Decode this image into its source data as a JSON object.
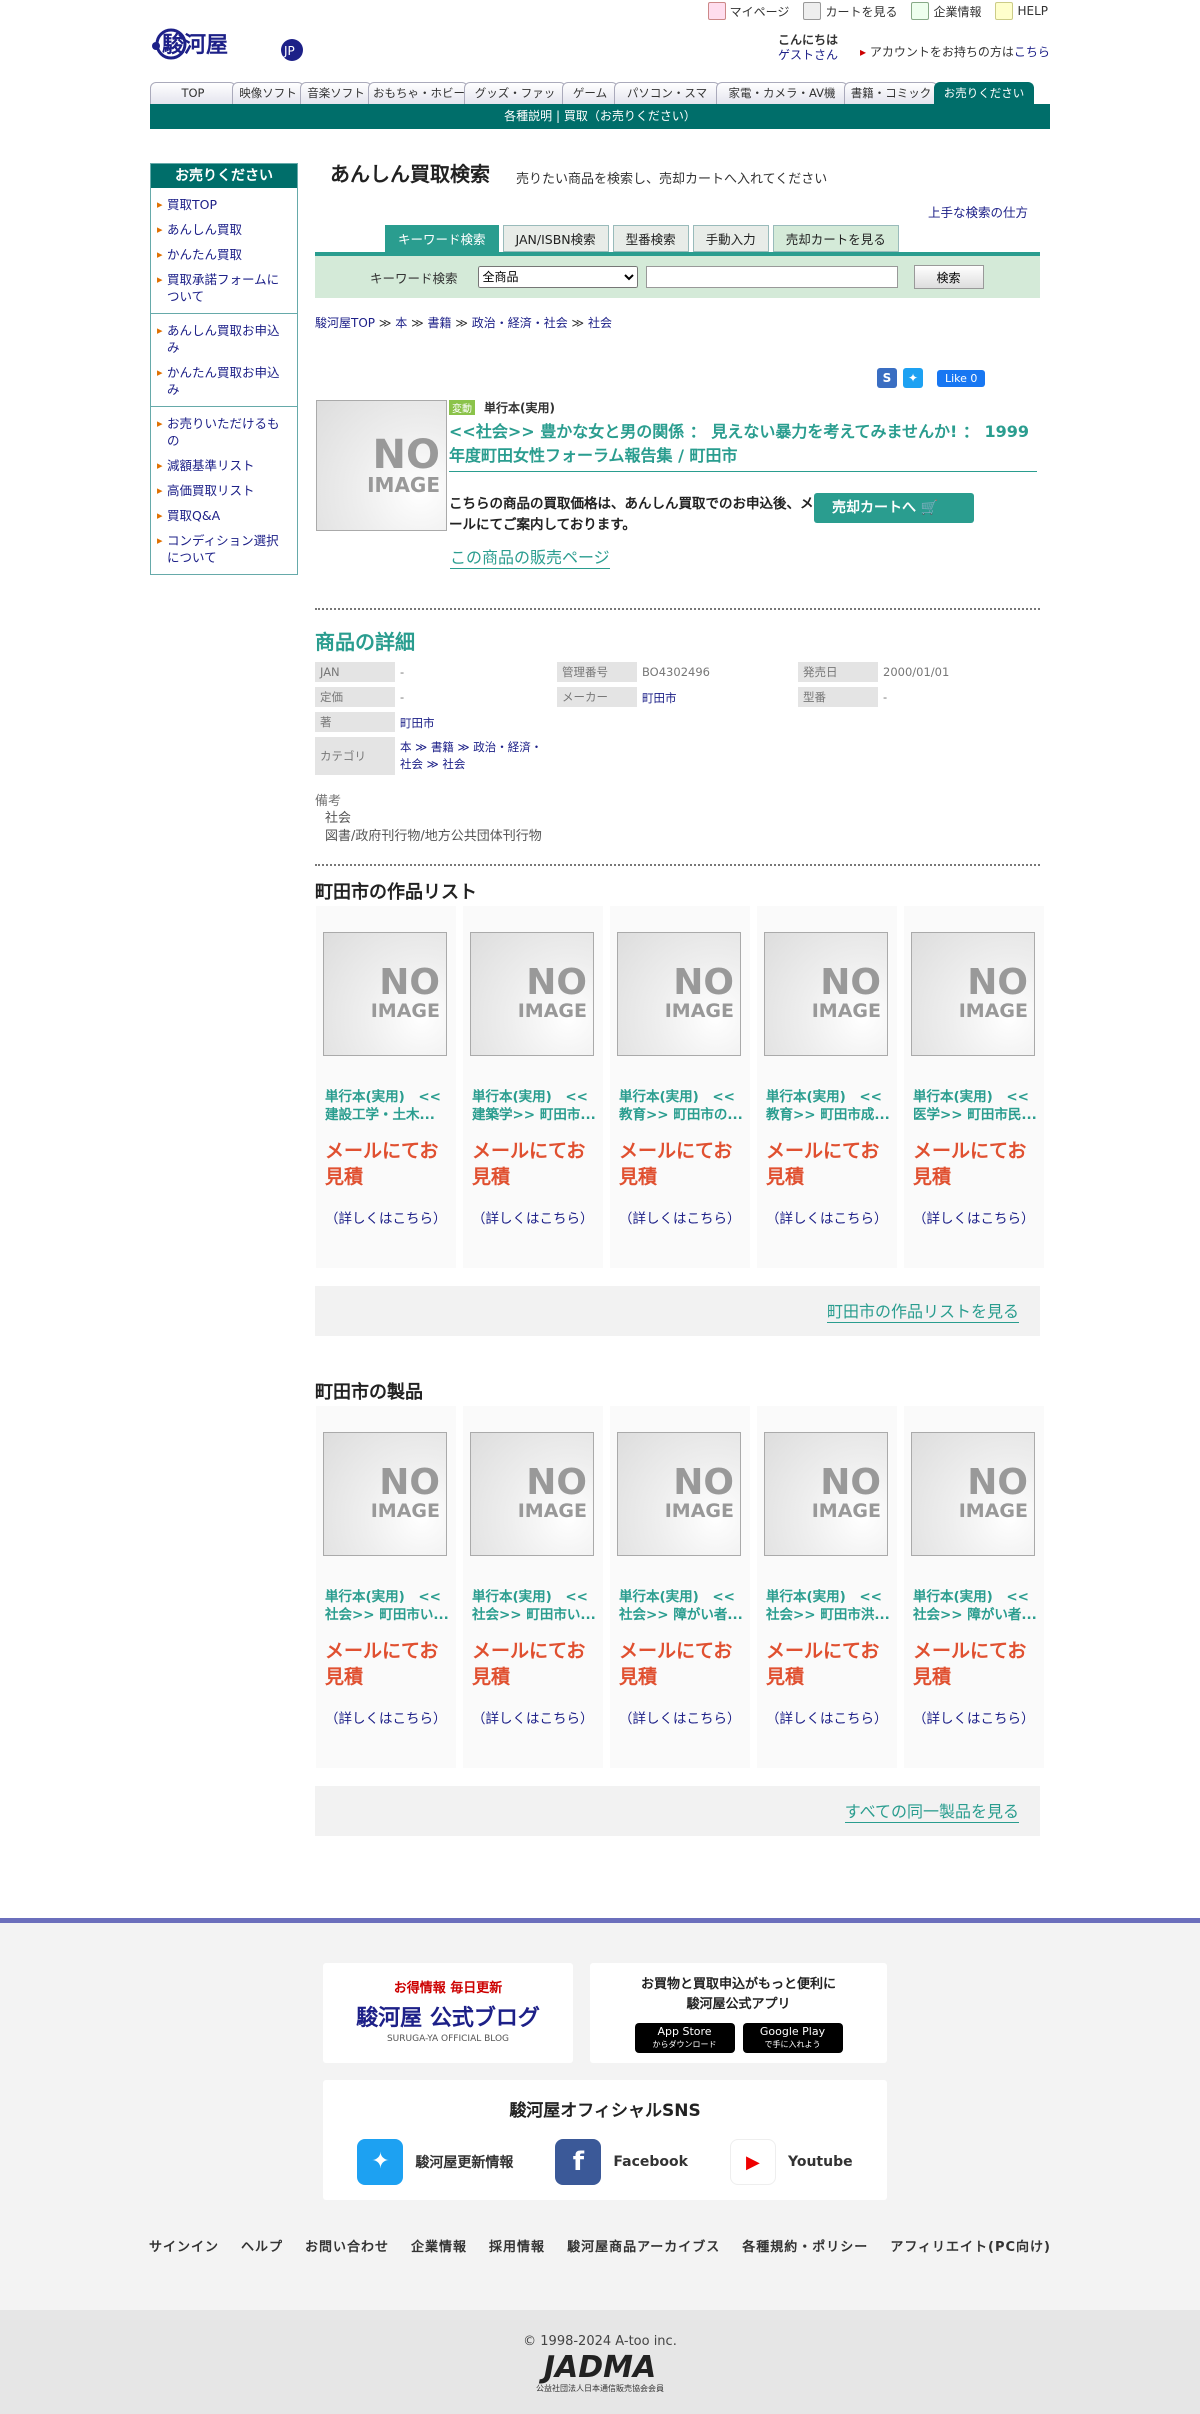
{
  "header": {
    "logo": "駿河屋",
    "logo_jp": "JP",
    "top_links": [
      "マイページ",
      "カートを見る",
      "企業情報",
      "HELP"
    ],
    "greeting": "こんにちは",
    "guest": "ゲストさん",
    "account_text": "アカウントをお持ちの方は",
    "account_link": "こちら",
    "tabs": [
      "TOP",
      "映像ソフト",
      "音楽ソフト",
      "おもちゃ・ホビー",
      "グッズ・ファッ",
      "ゲーム",
      "パソコン・スマ",
      "家電・カメラ・AV機",
      "書籍・コミック",
      "お売りください"
    ],
    "subbar": "各種説明 | 買取（お売りください）"
  },
  "sidebar": {
    "title": "お売りください",
    "group1": [
      "買取TOP",
      "あんしん買取",
      "かんたん買取",
      "買取承諾フォームについて"
    ],
    "group2": [
      "あんしん買取お申込み",
      "かんたん買取お申込み"
    ],
    "group3": [
      "お売りいただけるもの",
      "減額基準リスト",
      "高価買取リスト",
      "買取Q&A",
      "コンディション選択について"
    ]
  },
  "search": {
    "title": "あんしん買取検索",
    "subtitle": "売りたい商品を検索し、売却カートへ入れてください",
    "howto": "上手な検索の仕方",
    "tabs": [
      "キーワード検索",
      "JAN/ISBN検索",
      "型番検索",
      "手動入力",
      "売却カートを見る"
    ],
    "label": "キーワード検索",
    "select_value": "全商品",
    "button": "検索"
  },
  "breadcrumb": [
    "駿河屋TOP",
    "本",
    "書籍",
    "政治・経済・社会",
    "社会"
  ],
  "breadcrumb_sep": "≫",
  "social": {
    "s": "S",
    "like": "Like 0"
  },
  "product": {
    "noimage_a": "NO",
    "noimage_b": "IMAGE",
    "badge": "変動",
    "type": "単行本(実用)",
    "title": "<<社会>> 豊かな女と男の関係 ： 見えない暴力を考えてみませんか! ： 1999年度町田女性フォーラム報告集 / 町田市",
    "note": "こちらの商品の買取価格は、あんしん買取でのお申込後、メールにてご案内しております。",
    "cart_button": "売却カートへ",
    "sale_link": "この商品の販売ページ"
  },
  "details": {
    "heading": "商品の詳細",
    "rows": [
      {
        "k": "JAN",
        "v": "-"
      },
      {
        "k": "管理番号",
        "v": "BO4302496"
      },
      {
        "k": "発売日",
        "v": "2000/01/01"
      },
      {
        "k": "定価",
        "v": "-"
      },
      {
        "k": "メーカー",
        "v": "町田市"
      },
      {
        "k": "型番",
        "v": "-"
      },
      {
        "k": "著",
        "v": "町田市"
      }
    ],
    "category_label": "カテゴリ",
    "category": "本 ≫ 書籍 ≫ 政治・経済・社会 ≫ 社会",
    "remark_label": "備考",
    "remark_lines": [
      "社会",
      "図書/政府刊行物/地方公共団体刊行物"
    ]
  },
  "works": {
    "heading": "町田市の作品リスト",
    "items": [
      {
        "title": "単行本(実用)　<<建設工学・土木..."
      },
      {
        "title": "単行本(実用)　<<建築学>> 町田市..."
      },
      {
        "title": "単行本(実用)　<<教育>> 町田市の..."
      },
      {
        "title": "単行本(実用)　<<教育>> 町田市成..."
      },
      {
        "title": "単行本(実用)　<<医学>> 町田市民..."
      }
    ],
    "price": "メールにてお見積",
    "more": "（詳しくはこちら）",
    "more_link": "町田市の作品リストを見る"
  },
  "products": {
    "heading": "町田市の製品",
    "items": [
      {
        "title": "単行本(実用)　<<社会>> 町田市い..."
      },
      {
        "title": "単行本(実用)　<<社会>> 町田市い..."
      },
      {
        "title": "単行本(実用)　<<社会>> 障がい者..."
      },
      {
        "title": "単行本(実用)　<<社会>> 町田市洪..."
      },
      {
        "title": "単行本(実用)　<<社会>> 障がい者..."
      }
    ],
    "price": "メールにてお見積",
    "more": "（詳しくはこちら）",
    "more_link": "すべての同一製品を見る"
  },
  "footer": {
    "blog_top": "お得情報 毎日更新",
    "blog_name": "駿河屋 公式ブログ",
    "blog_sub": "SURUGA-YA OFFICIAL BLOG",
    "app_text": "お買物と買取申込がもっと便利に駿河屋公式アプリ",
    "appstore": "App Store",
    "appstore_sub": "からダウンロード",
    "googleplay": "Google Play",
    "googleplay_sub": "で手に入れよう",
    "sns_title": "駿河屋オフィシャルSNS",
    "sns": [
      "駿河屋更新情報",
      "Facebook",
      "Youtube"
    ],
    "links": [
      "サインイン",
      "ヘルプ",
      "お問い合わせ",
      "企業情報",
      "採用情報",
      "駿河屋商品アーカイブス",
      "各種規約・ポリシー",
      "アフィリエイト(PC向け)"
    ],
    "copyright": "© 1998-2024 A-too inc.",
    "jadma": "JADMA",
    "jadma_sub": "公益社団法人日本通信販売協会会員"
  },
  "colors": {
    "teal": "#2a9d8f",
    "dark_teal": "#006e6a",
    "navy": "#1d2088",
    "price": "#e05030"
  }
}
